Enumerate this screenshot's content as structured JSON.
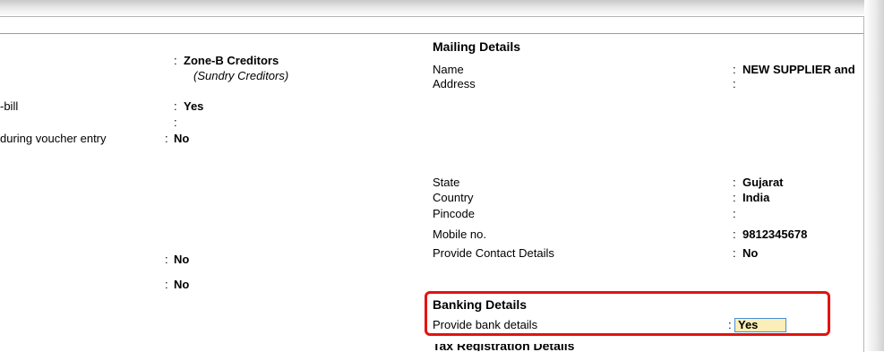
{
  "left": {
    "group_value": "Zone-B Creditors",
    "group_sub": "(Sundry Creditors)",
    "bill_label": "-bill",
    "bill_value": "Yes",
    "voucher_label": "during voucher entry",
    "voucher_value": "No",
    "row_a_value": "No",
    "row_b_value": "No",
    "colon": ":"
  },
  "mailing": {
    "heading": "Mailing Details",
    "name_label": "Name",
    "name_value": "NEW SUPPLIER and",
    "address_label": "Address",
    "state_label": "State",
    "state_value": "Gujarat",
    "country_label": "Country",
    "country_value": "India",
    "pincode_label": "Pincode",
    "mobile_label": "Mobile no.",
    "mobile_value": "9812345678",
    "contact_label": "Provide Contact Details",
    "contact_value": "No"
  },
  "banking": {
    "heading": "Banking Details",
    "provide_label": "Provide bank details",
    "provide_value": "Yes"
  },
  "footer_heading": "Tax Registration Details",
  "colors": {
    "highlight_border": "#e3130f",
    "field_bg": "#fbeeb8",
    "field_border": "#4a8fd6"
  }
}
